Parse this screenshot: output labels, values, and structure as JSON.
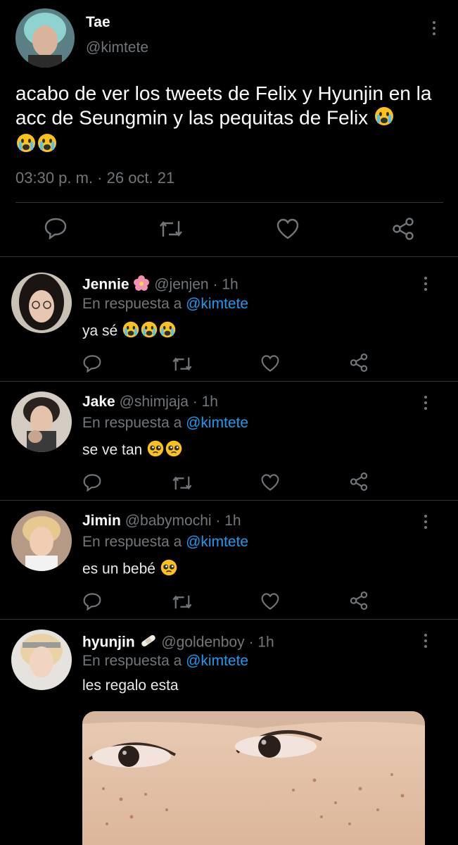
{
  "main_tweet": {
    "name": "Tae",
    "handle": "@kimtete",
    "text": "acabo de ver los tweets de Felix y Hyunjin en la acc de Seungmin y las pequitas de Felix",
    "timestamp": "03:30 p. m. · 26 oct. 21"
  },
  "replies": [
    {
      "name": "Jennie",
      "name_emoji": "flower-emoji",
      "handle": "@jenjen",
      "time": "· 1h",
      "in_reply_prefix": "En respuesta a",
      "in_reply_handle": "@kimtete",
      "text": "ya sé"
    },
    {
      "name": "Jake",
      "handle": "@shimjaja",
      "time": "· 1h",
      "in_reply_prefix": "En respuesta a",
      "in_reply_handle": "@kimtete",
      "text": "se ve tan"
    },
    {
      "name": "Jimin",
      "handle": "@babymochi",
      "time": "· 1h",
      "in_reply_prefix": "En respuesta a",
      "in_reply_handle": "@kimtete",
      "text": "es un bebé"
    },
    {
      "name": "hyunjin",
      "name_emoji": "bandage-emoji",
      "handle": "@goldenboy",
      "time": "· 1h",
      "in_reply_prefix": "En respuesta a",
      "in_reply_handle": "@kimtete",
      "text": "les regalo esta"
    }
  ],
  "icons": [
    "reply-icon",
    "retweet-icon",
    "like-icon",
    "share-icon",
    "more-icon"
  ],
  "colors": {
    "background": "#000000",
    "text": "#e7e9ea",
    "muted": "#71767b",
    "link": "#1d9bf0",
    "divider": "#2f3336"
  }
}
